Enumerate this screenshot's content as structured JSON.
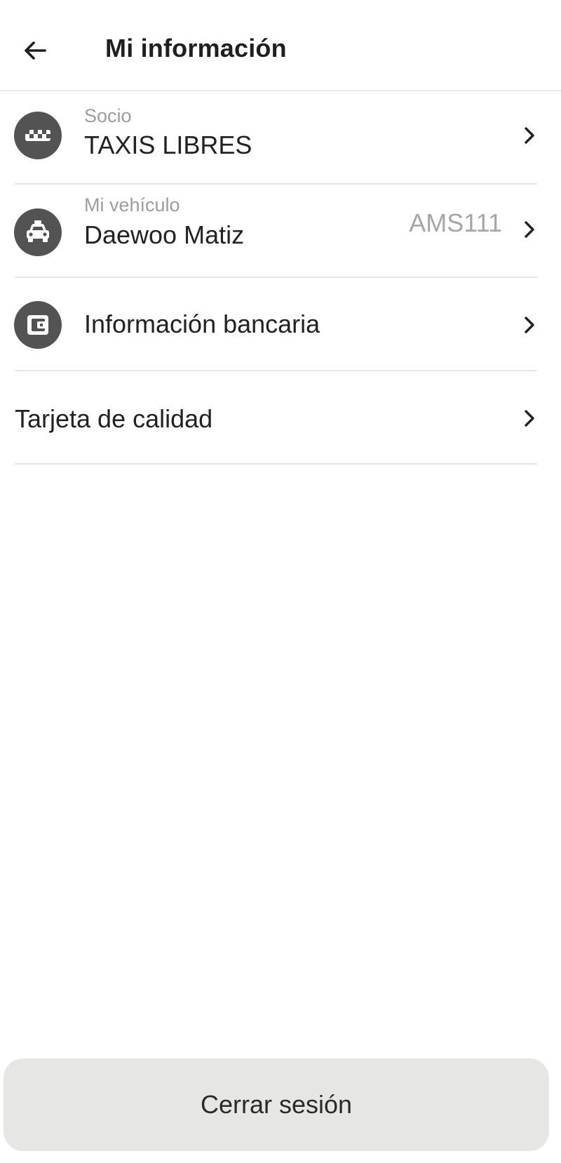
{
  "header": {
    "title": "Mi información",
    "back_icon": "arrow-left-icon"
  },
  "rows": [
    {
      "icon": "taxi-checker-icon",
      "subtitle": "Socio",
      "title": "TAXIS LIBRES",
      "value": ""
    },
    {
      "icon": "car-icon",
      "subtitle": "Mi vehículo",
      "title": "Daewoo Matiz",
      "value": "AMS111"
    },
    {
      "icon": "wallet-icon",
      "subtitle": "",
      "title": "Información bancaria",
      "value": ""
    },
    {
      "icon": "",
      "subtitle": "",
      "title": "Tarjeta de calidad",
      "value": ""
    }
  ],
  "footer": {
    "logout_label": "Cerrar sesión"
  },
  "colors": {
    "icon_bg": "#535353",
    "button_bg": "#e6e6e4",
    "secondary_text": "#9d9d9d"
  }
}
